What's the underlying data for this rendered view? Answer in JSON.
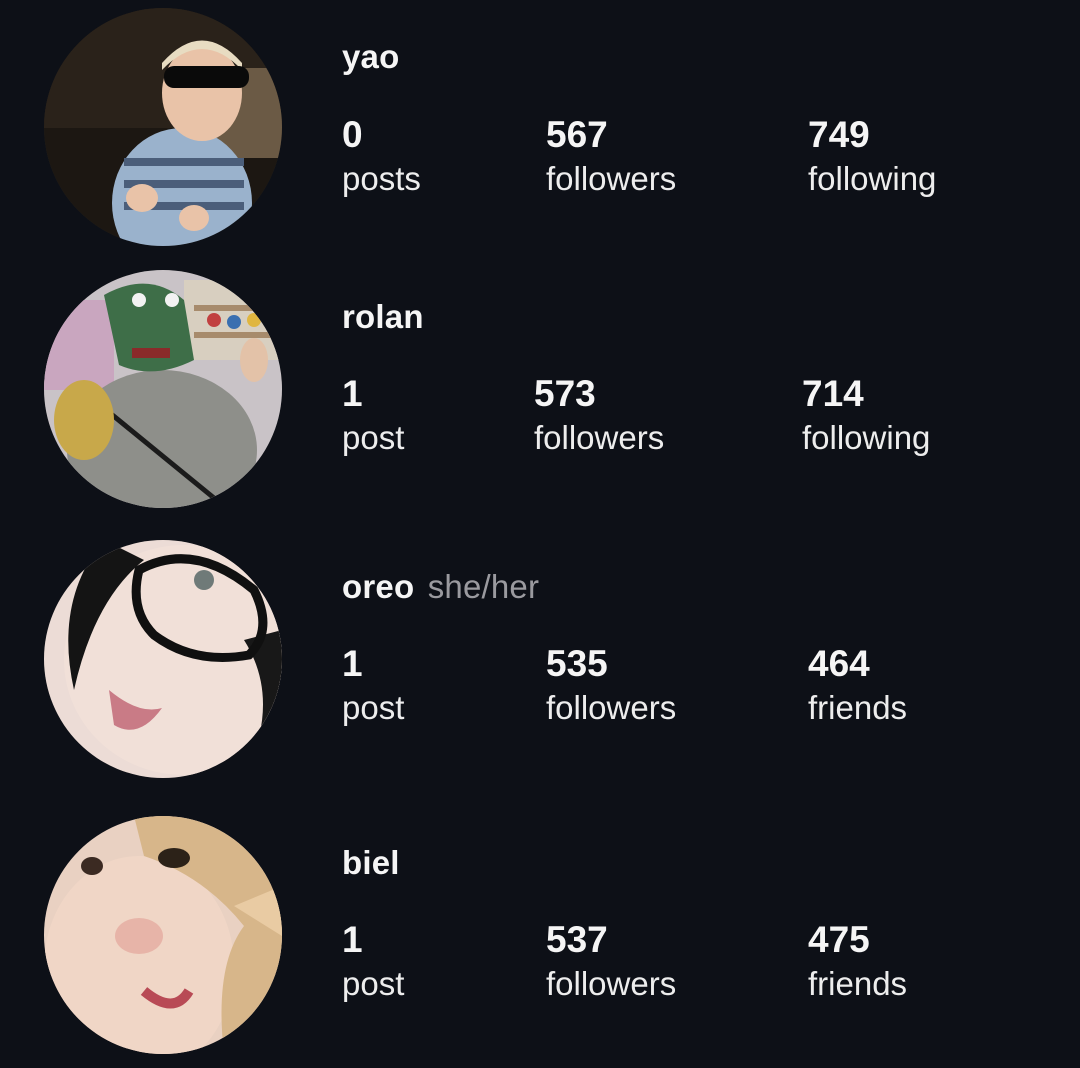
{
  "profiles": [
    {
      "username": "yao",
      "pronouns": "",
      "stats": [
        {
          "value": "0",
          "label": "posts"
        },
        {
          "value": "567",
          "label": "followers"
        },
        {
          "value": "749",
          "label": "following"
        }
      ]
    },
    {
      "username": "rolan",
      "pronouns": "",
      "stats": [
        {
          "value": "1",
          "label": "post"
        },
        {
          "value": "573",
          "label": "followers"
        },
        {
          "value": "714",
          "label": "following"
        }
      ]
    },
    {
      "username": "oreo",
      "pronouns": "she/her",
      "stats": [
        {
          "value": "1",
          "label": "post"
        },
        {
          "value": "535",
          "label": "followers"
        },
        {
          "value": "464",
          "label": "friends"
        }
      ]
    },
    {
      "username": "biel",
      "pronouns": "",
      "stats": [
        {
          "value": "1",
          "label": "post"
        },
        {
          "value": "537",
          "label": "followers"
        },
        {
          "value": "475",
          "label": "friends"
        }
      ]
    }
  ]
}
